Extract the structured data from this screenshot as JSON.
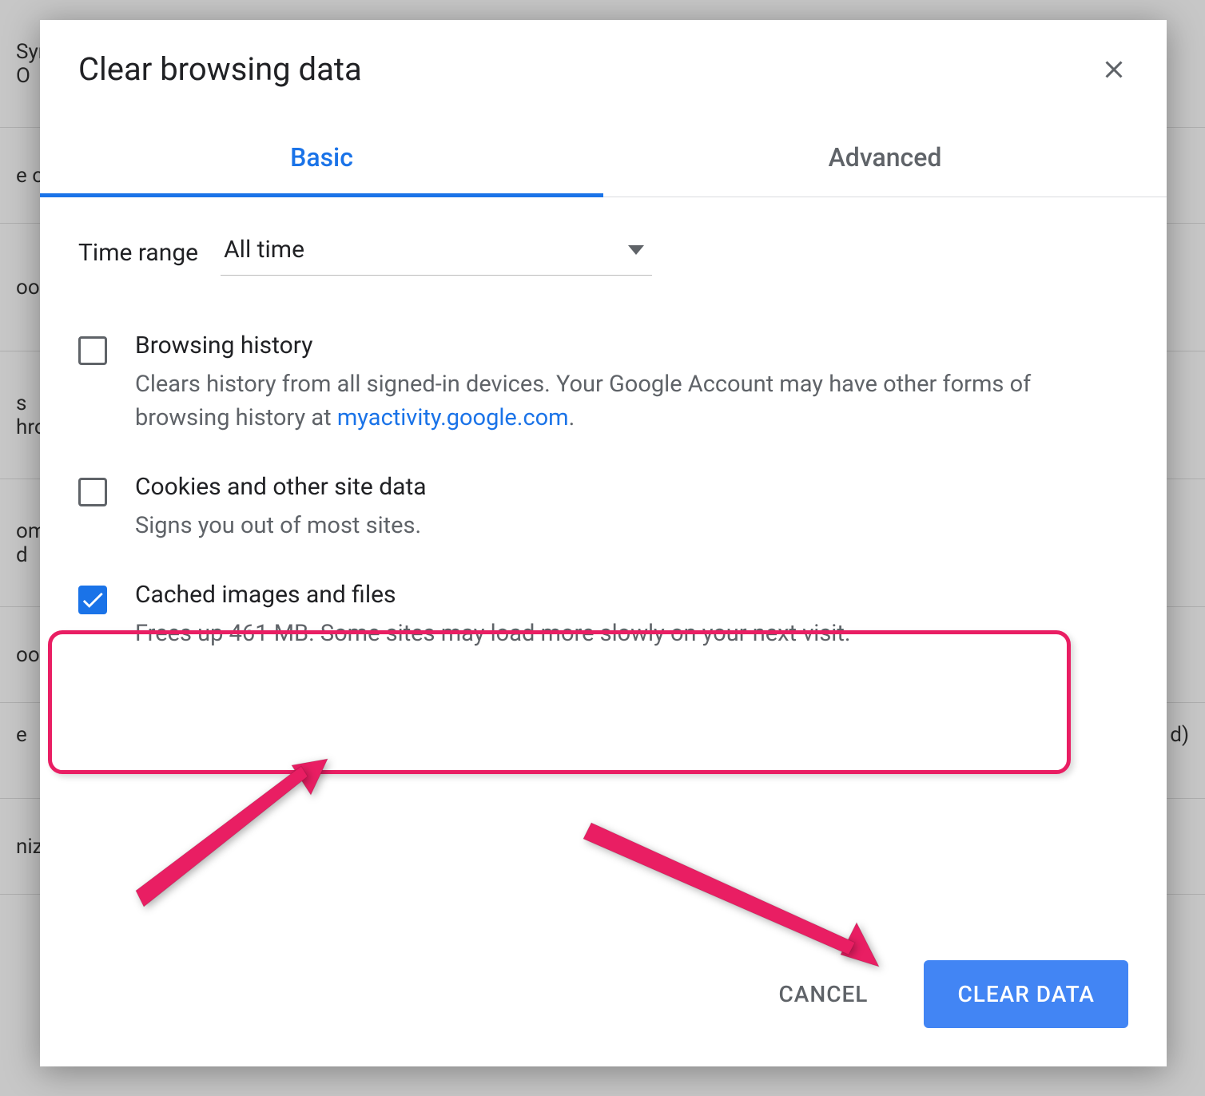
{
  "background": {
    "rows": [
      {
        "l1": "Sync",
        "l2": "O"
      },
      {
        "l1": "e oth"
      },
      {
        "l1": "",
        "l2": "ooo"
      },
      {
        "l1": "s",
        "l2": "hro"
      },
      {
        "l1": "ome",
        "l2": "d"
      },
      {
        "l1": "ook"
      },
      {
        "l1": "e",
        "r": "d)"
      },
      {
        "l1": "nize"
      }
    ]
  },
  "dialog": {
    "title": "Clear browsing data",
    "tabs": {
      "basic": "Basic",
      "advanced": "Advanced"
    },
    "timeRange": {
      "label": "Time range",
      "value": "All time"
    },
    "options": [
      {
        "title": "Browsing history",
        "desc_pre": "Clears history from all signed-in devices. Your Google Account may have other forms of browsing history at ",
        "link": "myactivity.google.com",
        "desc_post": ".",
        "checked": false
      },
      {
        "title": "Cookies and other site data",
        "desc": "Signs you out of most sites.",
        "checked": false
      },
      {
        "title": "Cached images and files",
        "desc": "Frees up 461 MB. Some sites may load more slowly on your next visit.",
        "checked": true
      }
    ],
    "actions": {
      "cancel": "CANCEL",
      "confirm": "CLEAR DATA"
    }
  }
}
